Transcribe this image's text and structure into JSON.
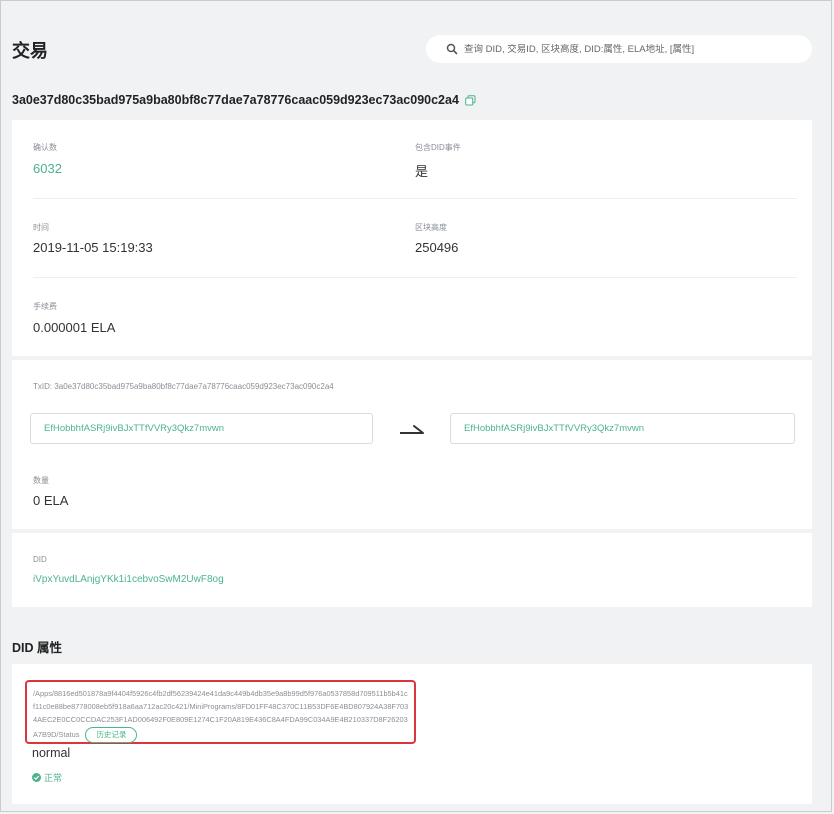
{
  "page": {
    "title": "交易"
  },
  "search": {
    "placeholder": "查询 DID, 交易ID, 区块高度, DID:属性, ELA地址, [属性]"
  },
  "transaction": {
    "hash": "3a0e37d80c35bad975a9ba80bf8c77dae7a78776caac059d923ec73ac090c2a4",
    "confirmations_label": "确认数",
    "confirmations_value": "6032",
    "contains_did_label": "包含DID事件",
    "contains_did_value": "是",
    "time_label": "时间",
    "time_value": "2019-11-05 15:19:33",
    "block_height_label": "区块高度",
    "block_height_value": "250496",
    "fee_label": "手续费",
    "fee_value": "0.000001 ELA"
  },
  "transfer": {
    "txid_line": "TxID: 3a0e37d80c35bad975a9ba80bf8c77dae7a78776caac059d923ec73ac090c2a4",
    "from_address": "EfHobbhfASRj9ivBJxTTfVVRy3Qkz7mvwn",
    "to_address": "EfHobbhfASRj9ivBJxTTfVVRy3Qkz7mvwn",
    "amount_label": "数量",
    "amount_value": "0 ELA"
  },
  "did": {
    "label": "DID",
    "value": "iVpxYuvdLAnjgYKk1i1cebvoSwM2UwF8og"
  },
  "did_attributes": {
    "section_title": "DID 属性",
    "path": "/Apps/8816ed501878a9f4404f5926c4fb2df56239424e41da9c449b4db35e9a8b99d5f976a0537858d709511b5b41cf11c0e88be8778008eb5f918a6aa712ac20c421/MiniPrograms/8FD01FF48C370C11B53DF6E4BD807924A38F7034AEC2E0CC0CCDAC253F1AD006492F0E809E1274C1F20A819E436C8A4FDA99C034A9E4B210337D8F26203A7B9D/Status",
    "history_button": "历史记录",
    "value": "normal",
    "status_text": "正常"
  },
  "colors": {
    "accent_green": "#4cb38a",
    "highlight_red": "#d9363e"
  },
  "icons": {
    "search": "search-icon",
    "copy": "copy-icon",
    "arrow": "arrow-right-icon",
    "status": "check-circle-icon"
  }
}
